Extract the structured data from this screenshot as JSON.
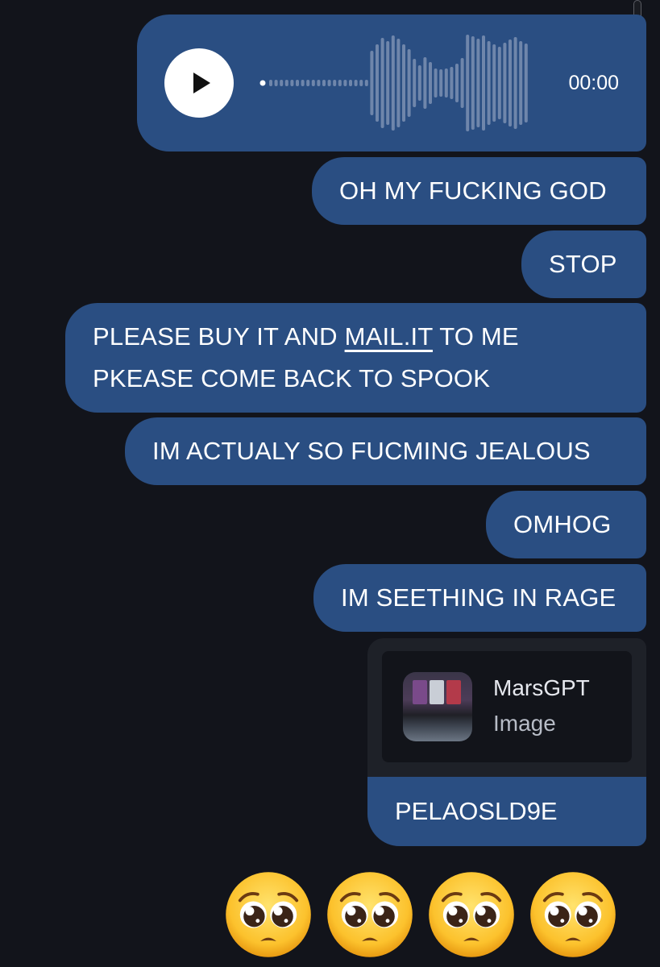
{
  "voice_message": {
    "duration": "00:00"
  },
  "messages": [
    {
      "text": "OH MY FUCKING GOD"
    },
    {
      "text": "STOP"
    },
    {
      "line1_before": "PLEASE BUY IT AND ",
      "line1_link": "MAIL.IT",
      "line1_after": " TO ME",
      "line2": "PKEASE COME BACK TO SPOOK"
    },
    {
      "text": "IM ACTUALY SO FUCMING JEALOUS"
    },
    {
      "text": "OMHOG"
    },
    {
      "text": "IM SEETHING IN RAGE"
    }
  ],
  "media_message": {
    "title": "MarsGPT",
    "subtitle": "Image",
    "caption": "PELAOSLD9E"
  },
  "emoji_reactions": [
    {
      "icon": "pleading-face-emoji"
    },
    {
      "icon": "pleading-face-emoji"
    },
    {
      "icon": "pleading-face-emoji"
    },
    {
      "icon": "pleading-face-emoji"
    }
  ],
  "colors": {
    "background": "#12141b",
    "bubble": "#2a4e82",
    "media_card": "#1e2128"
  }
}
